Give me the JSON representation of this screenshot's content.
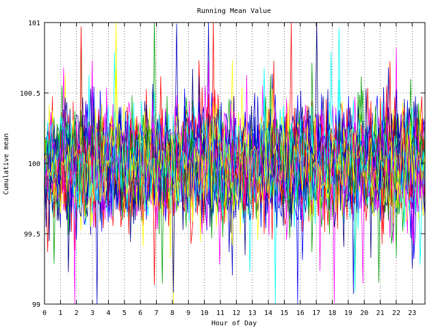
{
  "chart_data": {
    "type": "line",
    "title": "Running Mean Value",
    "xlabel": "Hour of Day",
    "ylabel": "Cumulative mean",
    "xlim": [
      0,
      23.8
    ],
    "ylim": [
      99,
      101
    ],
    "x_ticks": [
      "0",
      "1",
      "2",
      "3",
      "4",
      "5",
      "6",
      "7",
      "8",
      "9",
      "10",
      "11",
      "12",
      "13",
      "14",
      "15",
      "16",
      "17",
      "18",
      "19",
      "20",
      "21",
      "22",
      "23"
    ],
    "y_ticks": [
      "99",
      "99.5",
      "100",
      "100.5",
      "101"
    ],
    "grid": true,
    "legend": "none",
    "center": 100.0,
    "series_count": 30,
    "points_per_series": 240,
    "colors": [
      "#0000ff",
      "#ff0000",
      "#00a000",
      "#ff00ff",
      "#00ffff",
      "#ffff00",
      "#000080",
      "#0000c0"
    ]
  }
}
